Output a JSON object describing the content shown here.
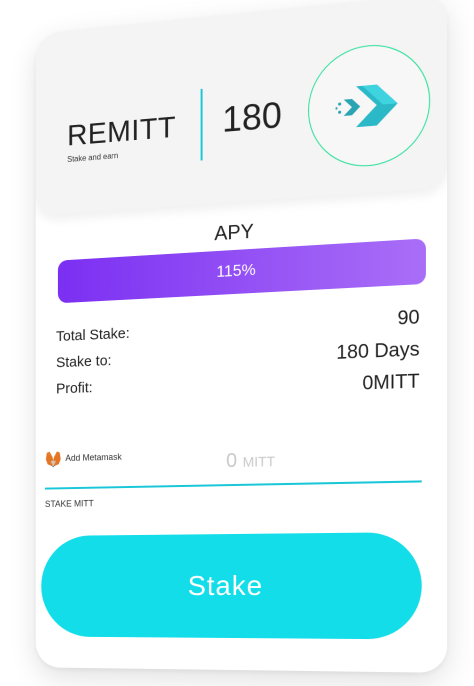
{
  "header": {
    "token_name": "REMITT",
    "token_subtitle": "Stake and earn",
    "days": "180",
    "logo_icon": "remitt-chevron-logo-icon"
  },
  "apy": {
    "label": "APY",
    "value": "115%",
    "fill_percent": 100
  },
  "details": {
    "total_stake_label": "Total Stake:",
    "total_stake_value": "90",
    "stake_to_label": "Stake to:",
    "stake_to_value": "180 Days",
    "profit_label": "Profit:",
    "profit_value": "0MITT"
  },
  "wallet": {
    "icon": "metamask-fox-icon",
    "label": "Add Metamask"
  },
  "amount": {
    "value": "0",
    "unit": "MITT",
    "field_label": "STAKE MITT"
  },
  "actions": {
    "stake_label": "Stake"
  },
  "colors": {
    "accent": "#12dde8",
    "purple": "#7b2ff2",
    "logo_border": "#2fe09b"
  }
}
